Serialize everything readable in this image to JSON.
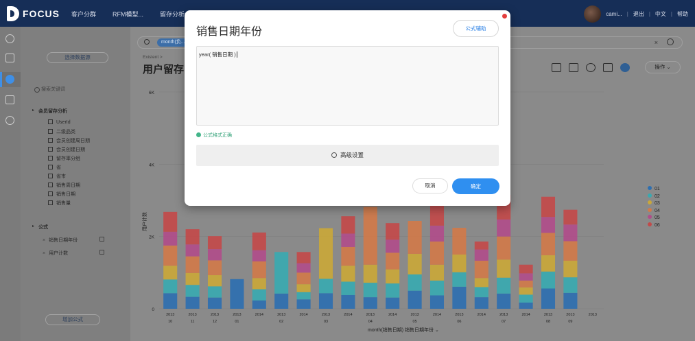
{
  "app": {
    "logo_text": "FOCUS",
    "nav": [
      "客户分群",
      "RFM模型...",
      "留存分析",
      "…"
    ],
    "user": "cami...",
    "links": [
      "退出",
      "中文",
      "帮助"
    ]
  },
  "left_panel": {
    "select_dataset_label": "选择数据源",
    "search_placeholder": "搜索关键词",
    "group_title": "会员留存分析",
    "fields": [
      "UserId",
      "二级品类",
      "会员创建周日期",
      "会员创建日期",
      "留存率分组",
      "省",
      "省市",
      "销售周日期",
      "销售日期",
      "销售量"
    ],
    "formula_group_title": "公式",
    "formulas": [
      "销售日期年份",
      "用户计数"
    ],
    "add_formula_label": "增加公式"
  },
  "main": {
    "filter_chip": "month(负...",
    "breadcrumb": "Existent >",
    "page_title": "用户留存图",
    "operate_label": "操作"
  },
  "colors": {
    "series": [
      "#2e6fb0",
      "#3aa9b0",
      "#c9a73a",
      "#d07a4a",
      "#b04d8a",
      "#c24a4a"
    ]
  },
  "chart_data": {
    "type": "bar",
    "stacked": true,
    "ylim": [
      0,
      6000
    ],
    "yticks": [
      "0",
      "2K",
      "4K",
      "6K"
    ],
    "ylabel": "用户计数",
    "xlabel": "month(销售日期)  销售日期年份",
    "categories": [
      [
        "2013",
        "10"
      ],
      [
        "2013",
        "11"
      ],
      [
        "2013",
        "12"
      ],
      [
        "2013",
        "01"
      ],
      [
        "2014",
        ""
      ],
      [
        "2013",
        "02"
      ],
      [
        "2014",
        ""
      ],
      [
        "2013",
        "03"
      ],
      [
        "2014",
        ""
      ],
      [
        "2013",
        "04"
      ],
      [
        "2014",
        ""
      ],
      [
        "2013",
        "05"
      ],
      [
        "2014",
        ""
      ],
      [
        "2013",
        "06"
      ],
      [
        "2014",
        ""
      ],
      [
        "2013",
        "07"
      ],
      [
        "2014",
        ""
      ],
      [
        "2013",
        "08"
      ],
      [
        "2013",
        "09"
      ],
      [
        "2013",
        ""
      ]
    ],
    "series": [
      {
        "name": "01",
        "values": [
          430,
          330,
          310,
          820,
          230,
          420,
          260,
          430,
          380,
          320,
          310,
          500,
          370,
          610,
          320,
          420,
          170,
          560,
          440,
          0
        ]
      },
      {
        "name": "02",
        "values": [
          380,
          330,
          310,
          0,
          310,
          1150,
          200,
          400,
          370,
          400,
          390,
          450,
          410,
          400,
          280,
          440,
          220,
          470,
          430,
          0
        ]
      },
      {
        "name": "03",
        "values": [
          380,
          330,
          310,
          0,
          310,
          0,
          220,
          1400,
          440,
          500,
          390,
          570,
          440,
          490,
          250,
          500,
          200,
          450,
          460,
          0
        ]
      },
      {
        "name": "04",
        "values": [
          560,
          460,
          410,
          0,
          460,
          0,
          320,
          0,
          520,
          1600,
          460,
          910,
          640,
          740,
          480,
          640,
          190,
          620,
          540,
          0
        ]
      },
      {
        "name": "05",
        "values": [
          380,
          330,
          310,
          0,
          310,
          0,
          260,
          0,
          370,
          0,
          360,
          0,
          440,
          0,
          310,
          470,
          200,
          440,
          460,
          0
        ]
      },
      {
        "name": "06",
        "values": [
          550,
          420,
          360,
          0,
          490,
          0,
          310,
          0,
          480,
          0,
          460,
          0,
          560,
          0,
          220,
          680,
          240,
          560,
          410,
          0
        ]
      }
    ]
  },
  "modal": {
    "title": "销售日期年份",
    "assist_label": "公式辅助",
    "formula": "year( 销售日期 )",
    "status": "公式格式正确",
    "advanced_label": "高级设置",
    "cancel_label": "取消",
    "ok_label": "确定"
  }
}
